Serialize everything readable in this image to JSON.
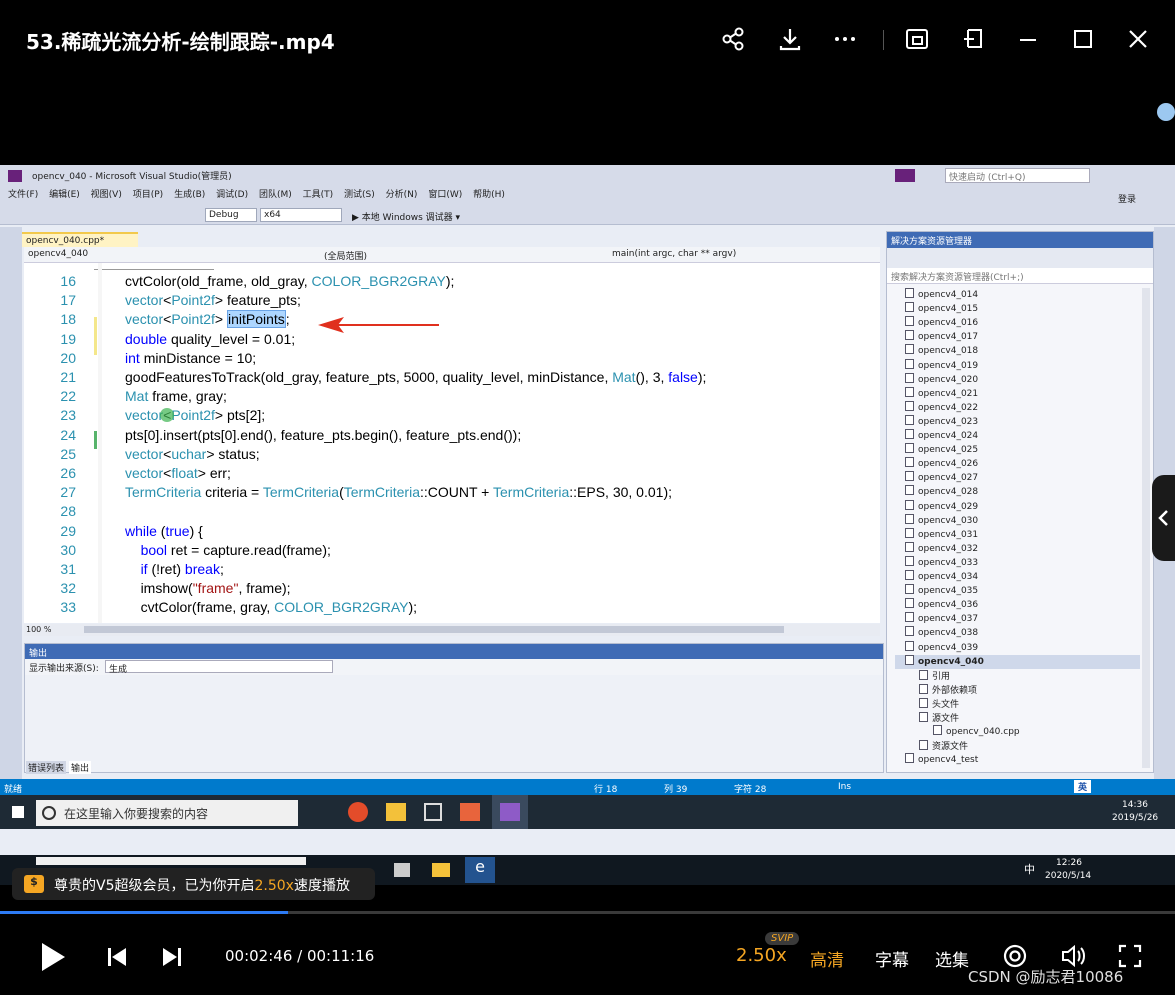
{
  "player": {
    "title": "53.稀疏光流分析-绘制跟踪-.mp4",
    "time": "00:02:46 / 00:11:16",
    "speed": "2.50x",
    "speed_badge": "SVIP",
    "quality": "高清",
    "subtitle": "字幕",
    "episodes": "选集",
    "watermark": "CSDN @励志君10086",
    "progress_fraction": 0.245,
    "vip_notice_prefix": "尊贵的V5超级会员，已为你开启",
    "vip_notice_speed": "2.50x",
    "vip_notice_suffix": "速度播放",
    "accent_color": "#f5a623"
  },
  "vs": {
    "title": "opencv_040 - Microsoft Visual Studio(管理员)",
    "quick_launch": "快速启动 (Ctrl+Q)",
    "login": "登录",
    "menu": [
      "文件(F)",
      "编辑(E)",
      "视图(V)",
      "项目(P)",
      "生成(B)",
      "调试(D)",
      "团队(M)",
      "工具(T)",
      "测试(S)",
      "分析(N)",
      "窗口(W)",
      "帮助(H)"
    ],
    "config": "Debug",
    "platform": "x64",
    "run_target": "▶ 本地 Windows 调试器 ▾",
    "doc_tab": "opencv_040.cpp*",
    "nav_project": "opencv4_040",
    "nav_scope": "(全局范围)",
    "nav_func": "main(int argc, char ** argv)",
    "zoom": "100 %",
    "output_title": "输出",
    "output_source_label": "显示输出来源(S):",
    "output_source_value": "生成",
    "bottom_tabs": [
      "错误列表",
      "输出"
    ],
    "status": {
      "left": "就绪",
      "line": "行 18",
      "col": "列 39",
      "char": "字符 28",
      "mode": "Ins"
    },
    "solution_title": "解决方案资源管理器",
    "solution_search": "搜索解决方案资源管理器(Ctrl+;)",
    "solution_items": [
      "opencv4_014",
      "opencv4_015",
      "opencv4_016",
      "opencv4_017",
      "opencv4_018",
      "opencv4_019",
      "opencv4_020",
      "opencv4_021",
      "opencv4_022",
      "opencv4_023",
      "opencv4_024",
      "opencv4_025",
      "opencv4_026",
      "opencv4_027",
      "opencv4_028",
      "opencv4_029",
      "opencv4_030",
      "opencv4_031",
      "opencv4_032",
      "opencv4_033",
      "opencv4_034",
      "opencv4_035",
      "opencv4_036",
      "opencv4_037",
      "opencv4_038",
      "opencv4_039"
    ],
    "active_project": "opencv4_040",
    "project_children": [
      "引用",
      "外部依赖项",
      "头文件",
      "源文件"
    ],
    "source_file": "opencv_040.cpp",
    "resource_files": "资源文件",
    "last_project": "opencv4_test"
  },
  "code_lines": [
    {
      "n": "16",
      "t": "cvtColor(old_frame, old_gray, COLOR_BGR2GRAY);"
    },
    {
      "n": "17",
      "t": "vector<Point2f> feature_pts;"
    },
    {
      "n": "18",
      "t": "vector<Point2f> initPoints;"
    },
    {
      "n": "19",
      "t": "double quality_level = 0.01;"
    },
    {
      "n": "20",
      "t": "int minDistance = 10;"
    },
    {
      "n": "21",
      "t": "goodFeaturesToTrack(old_gray, feature_pts, 5000, quality_level, minDistance, Mat(), 3, false);"
    },
    {
      "n": "22",
      "t": "Mat frame, gray;"
    },
    {
      "n": "23",
      "t": "vector<Point2f> pts[2];"
    },
    {
      "n": "24",
      "t": "pts[0].insert(pts[0].end(), feature_pts.begin(), feature_pts.end());"
    },
    {
      "n": "25",
      "t": "vector<uchar> status;"
    },
    {
      "n": "26",
      "t": "vector<float> err;"
    },
    {
      "n": "27",
      "t": "TermCriteria criteria = TermCriteria(TermCriteria::COUNT + TermCriteria::EPS, 30, 0.01);"
    },
    {
      "n": "28",
      "t": ""
    },
    {
      "n": "29",
      "t": "while (true) {"
    },
    {
      "n": "30",
      "t": "    bool ret = capture.read(frame);"
    },
    {
      "n": "31",
      "t": "    if (!ret) break;"
    },
    {
      "n": "32",
      "t": "    imshow(\"frame\", frame);"
    },
    {
      "n": "33",
      "t": "    cvtColor(frame, gray, COLOR_BGR2GRAY);"
    }
  ],
  "taskbar": {
    "search_placeholder": "在这里输入你要搜索的内容",
    "time1": "14:36",
    "date1": "2019/5/26",
    "ime1": "英",
    "time2": "12:26",
    "date2": "2020/5/14",
    "ime2": "中"
  }
}
